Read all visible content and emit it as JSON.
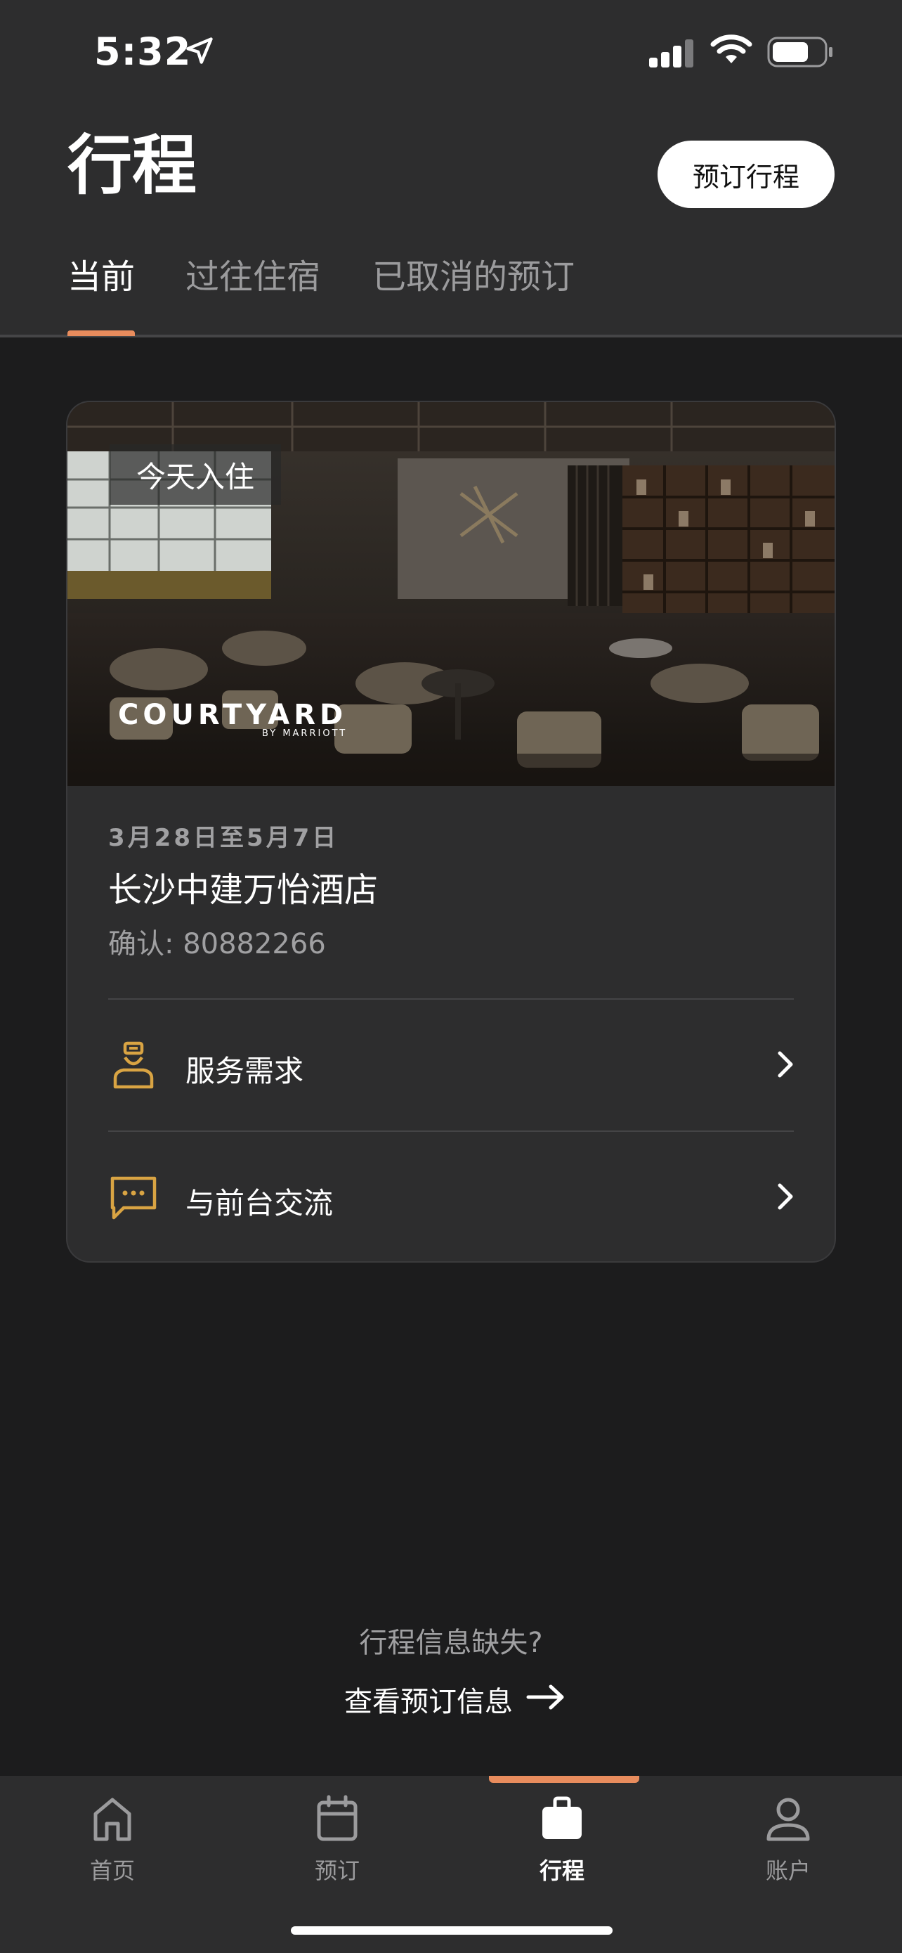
{
  "status_bar": {
    "time": "5:32"
  },
  "header": {
    "title": "行程",
    "book_button": "预订行程"
  },
  "tabs": [
    {
      "label": "当前",
      "active": true
    },
    {
      "label": "过往住宿",
      "active": false
    },
    {
      "label": "已取消的预订",
      "active": false
    }
  ],
  "reservation": {
    "badge": "今天入住",
    "brand": "COURTYARD",
    "brand_sub": "BY MARRIOTT",
    "dates": "3月28日至5月7日",
    "hotel_name": "长沙中建万怡酒店",
    "confirmation": "确认: 80882266",
    "actions": [
      {
        "label": "服务需求",
        "icon": "concierge-icon"
      },
      {
        "label": "与前台交流",
        "icon": "chat-bubble-icon"
      }
    ]
  },
  "missing": {
    "question": "行程信息缺失?",
    "link": "查看预订信息"
  },
  "bottom_nav": [
    {
      "label": "首页",
      "icon": "home-icon",
      "active": false
    },
    {
      "label": "预订",
      "icon": "calendar-icon",
      "active": false
    },
    {
      "label": "行程",
      "icon": "briefcase-icon",
      "active": true
    },
    {
      "label": "账户",
      "icon": "person-icon",
      "active": false
    }
  ],
  "colors": {
    "accent": "#e88c5d",
    "gold": "#d9a443",
    "background": "#1c1c1d",
    "surface": "#2d2d2e"
  }
}
